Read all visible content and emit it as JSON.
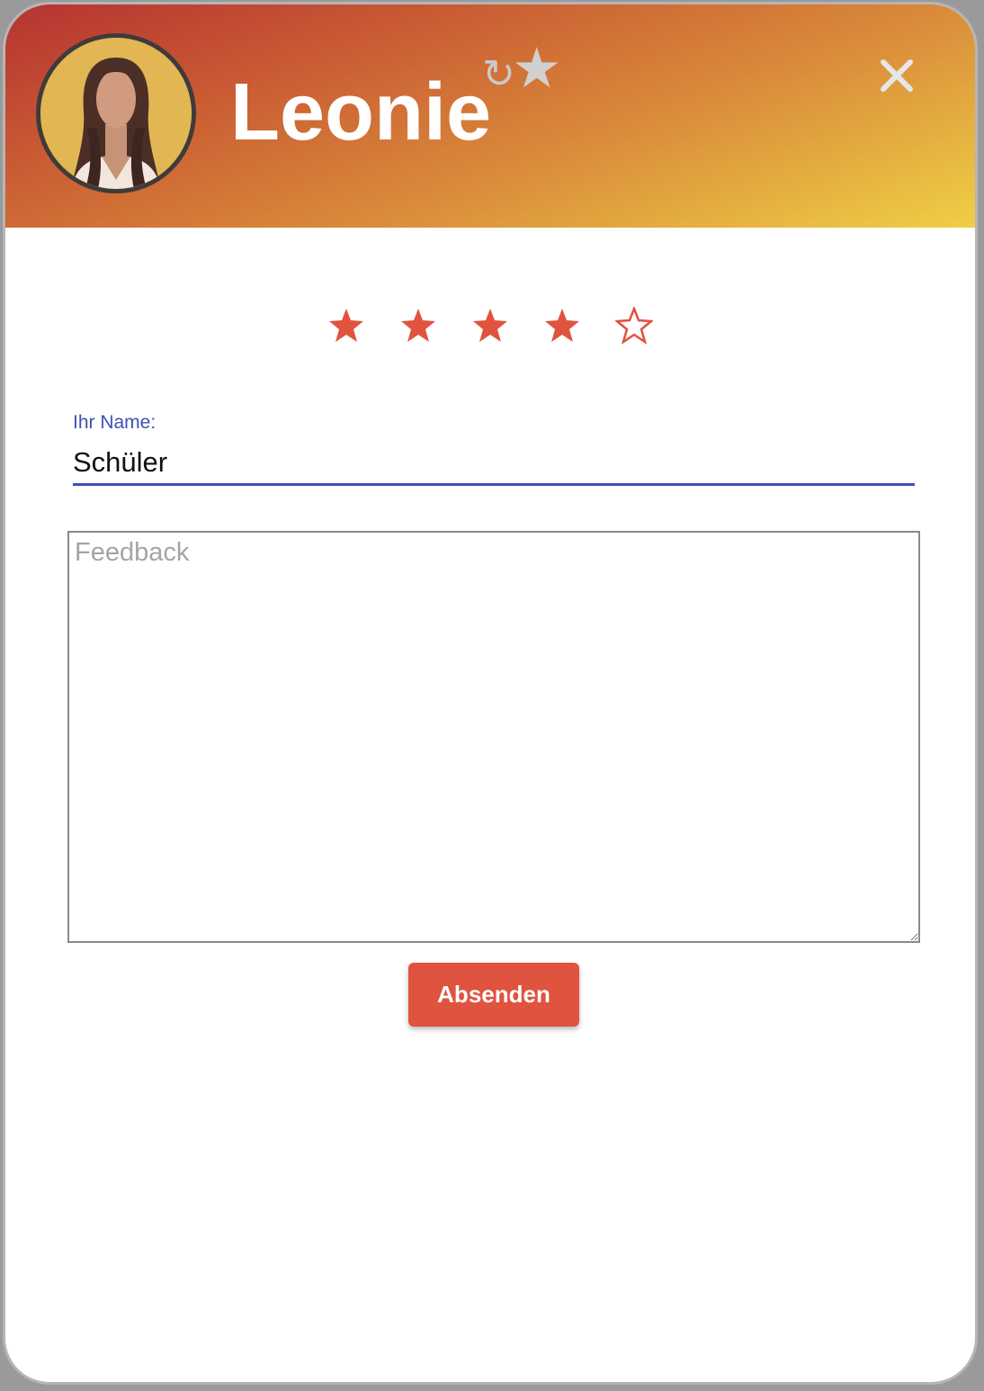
{
  "header": {
    "title": "Leonie",
    "avatar_icon": "woman-avatar-icon",
    "favorite_icons": [
      "refresh-icon",
      "star-icon"
    ],
    "close_icon": "close-icon"
  },
  "rating": {
    "value": 4,
    "max": 5,
    "color": "#e0533f"
  },
  "form": {
    "name_label": "Ihr Name:",
    "name_value": "Schüler",
    "feedback_placeholder": "Feedback",
    "submit_label": "Absenden"
  },
  "colors": {
    "accent": "#3f51b5",
    "button": "#e0533f",
    "header_gradient": [
      "#b53332",
      "#efcf45"
    ]
  }
}
